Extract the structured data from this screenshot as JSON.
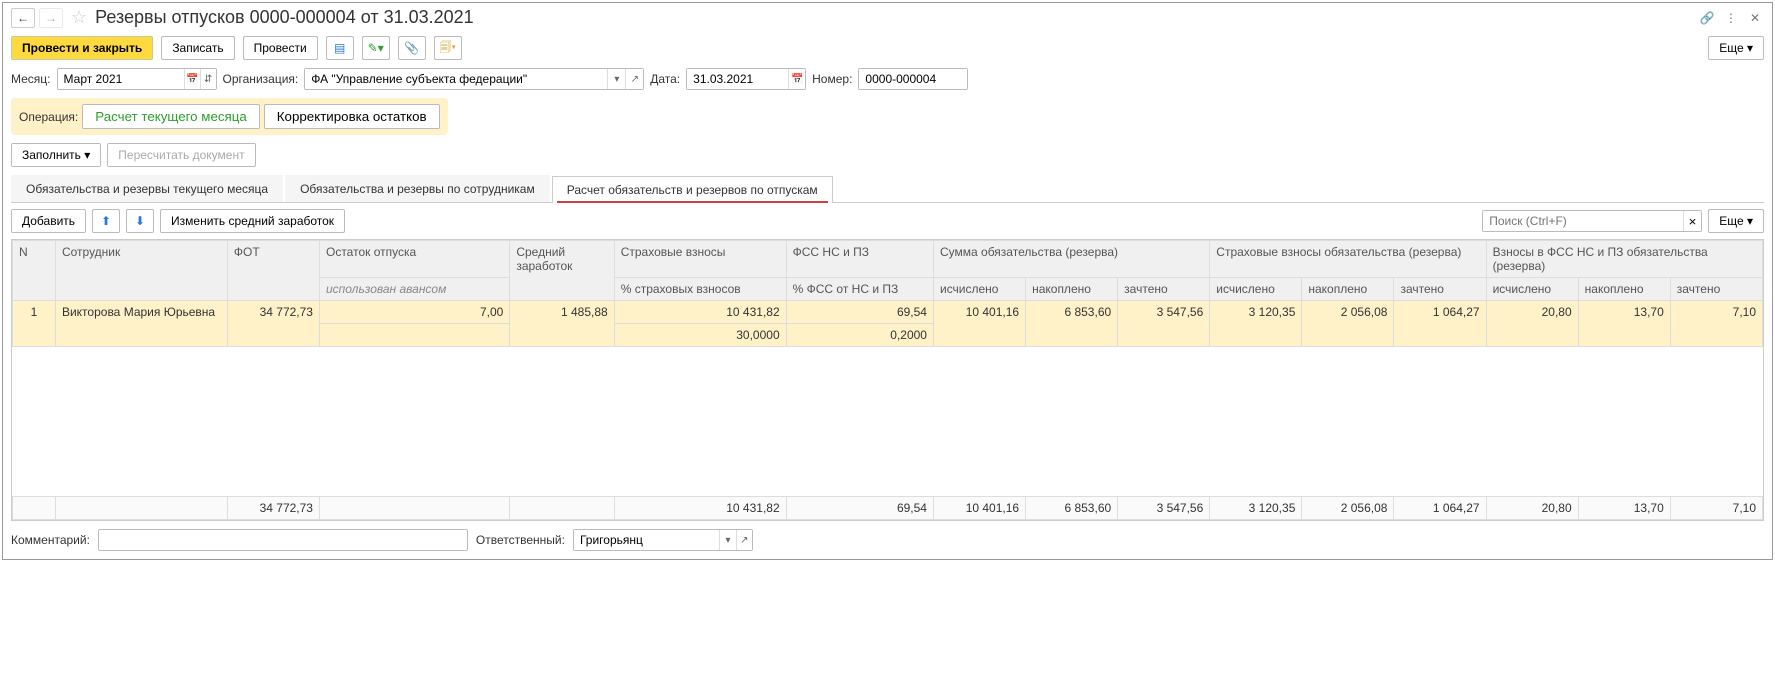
{
  "title": "Резервы отпусков 0000-000004 от 31.03.2021",
  "toolbar": {
    "post_close": "Провести и закрыть",
    "write": "Записать",
    "post": "Провести",
    "more": "Еще"
  },
  "fields": {
    "month_label": "Месяц:",
    "month_value": "Март 2021",
    "org_label": "Организация:",
    "org_value": "ФА \"Управление субъекта федерации\"",
    "date_label": "Дата:",
    "date_value": "31.03.2021",
    "number_label": "Номер:",
    "number_value": "0000-000004"
  },
  "operation": {
    "label": "Операция:",
    "calc_current": "Расчет текущего месяца",
    "adj_balance": "Корректировка остатков"
  },
  "actions": {
    "fill": "Заполнить",
    "recalc": "Пересчитать документ"
  },
  "tabs": {
    "t1": "Обязательства и резервы текущего месяца",
    "t2": "Обязательства и резервы по сотрудникам",
    "t3": "Расчет обязательств и резервов по отпускам"
  },
  "tabtoolbar": {
    "add": "Добавить",
    "edit_avg": "Изменить средний заработок",
    "search_placeholder": "Поиск (Ctrl+F)",
    "more": "Еще"
  },
  "headers": {
    "n": "N",
    "employee": "Сотрудник",
    "fot": "ФОТ",
    "balance": "Остаток отпуска",
    "balance_sub": "использован авансом",
    "avg": "Средний заработок",
    "ins": "Страховые взносы",
    "ins_sub": "% страховых взносов",
    "fss": "ФСС НС и ПЗ",
    "fss_sub": "% ФСС от НС и ПЗ",
    "sum_oblig": "Сумма обязательства (резерва)",
    "ins_oblig": "Страховые взносы обязательства (резерва)",
    "fss_oblig": "Взносы в ФСС НС и ПЗ обязательства (резерва)",
    "calc": "исчислено",
    "accum": "накоплено",
    "offset": "зачтено"
  },
  "rows": [
    {
      "n": "1",
      "employee": "Викторова Мария Юрьевна",
      "fot": "34 772,73",
      "balance": "7,00",
      "avg": "1 485,88",
      "ins": "10 431,82",
      "ins_pct": "30,0000",
      "fss": "69,54",
      "fss_pct": "0,2000",
      "sum_calc": "10 401,16",
      "sum_accum": "6 853,60",
      "sum_offset": "3 547,56",
      "ins_calc": "3 120,35",
      "ins_accum": "2 056,08",
      "ins_offset": "1 064,27",
      "fss_calc": "20,80",
      "fss_accum": "13,70",
      "fss_offset": "7,10"
    }
  ],
  "totals": {
    "fot": "34 772,73",
    "ins": "10 431,82",
    "fss": "69,54",
    "sum_calc": "10 401,16",
    "sum_accum": "6 853,60",
    "sum_offset": "3 547,56",
    "ins_calc": "3 120,35",
    "ins_accum": "2 056,08",
    "ins_offset": "1 064,27",
    "fss_calc": "20,80",
    "fss_accum": "13,70",
    "fss_offset": "7,10"
  },
  "bottom": {
    "comment_label": "Комментарий:",
    "responsible_label": "Ответственный:",
    "responsible_value": "Григорьянц"
  }
}
